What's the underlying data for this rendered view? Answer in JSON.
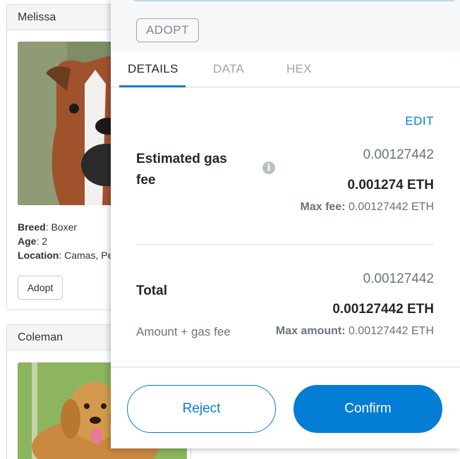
{
  "cards": [
    {
      "name": "Melissa",
      "breed_label": "Breed",
      "breed": "Boxer",
      "age_label": "Age",
      "age": "2",
      "location_label": "Location",
      "location": "Camas, Pe",
      "adopt_label": "Adopt"
    },
    {
      "name": "Coleman"
    }
  ],
  "modal": {
    "action_chip": "ADOPT",
    "tabs": [
      "DETAILS",
      "DATA",
      "HEX"
    ],
    "edit_label": "EDIT",
    "gas": {
      "label": "Estimated gas fee",
      "secondary": "0.00127442",
      "primary": "0.001274 ETH",
      "max_label": "Max fee:",
      "max_value": "0.00127442 ETH"
    },
    "total": {
      "label": "Total",
      "secondary": "0.00127442",
      "primary": "0.00127442 ETH",
      "sub_label": "Amount + gas fee",
      "max_label": "Max amount:",
      "max_value": "0.00127442 ETH"
    },
    "reject_label": "Reject",
    "confirm_label": "Confirm"
  },
  "colors": {
    "accent": "#037dd6",
    "muted_text": "#6a737d"
  },
  "icons": {
    "info": "info-icon"
  }
}
